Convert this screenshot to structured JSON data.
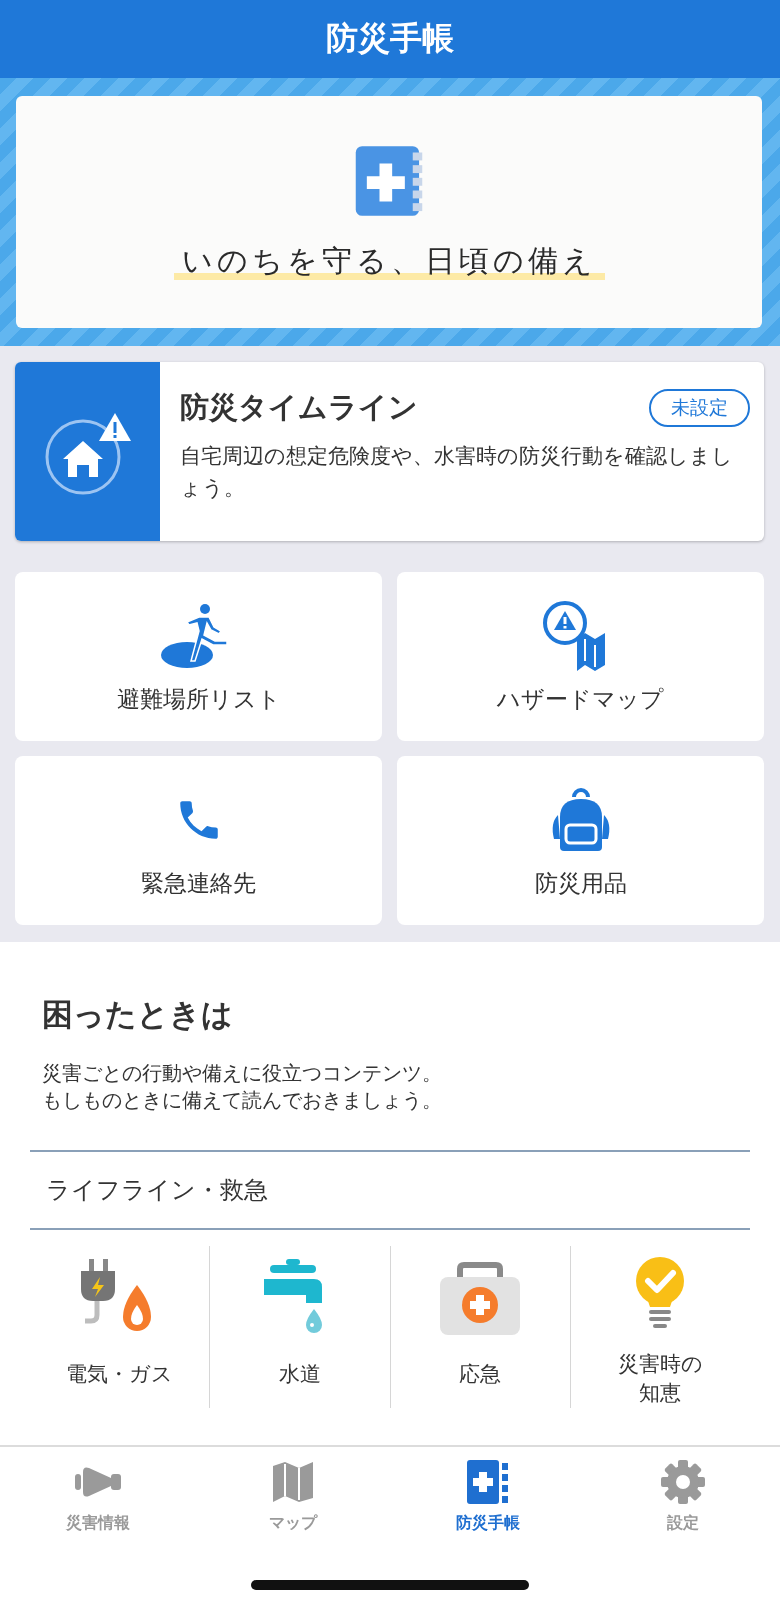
{
  "header": {
    "title": "防災手帳"
  },
  "banner": {
    "tagline": "いのちを守る、日頃の備え"
  },
  "timeline": {
    "title": "防災タイムライン",
    "status": "未設定",
    "description": "自宅周辺の想定危険度や、水害時の防災行動を確認しましょう。"
  },
  "menu": [
    {
      "label": "避難場所リスト"
    },
    {
      "label": "ハザードマップ"
    },
    {
      "label": "緊急連絡先"
    },
    {
      "label": "防災用品"
    }
  ],
  "help": {
    "title": "困ったときは",
    "description": [
      "災害ごとの行動や備えに役立つコンテンツ。",
      "もしものときに備えて読んでおきましょう。"
    ],
    "category": "ライフライン・救急",
    "items": [
      {
        "label": "電気・ガス"
      },
      {
        "label": "水道"
      },
      {
        "label": "応急"
      },
      {
        "label": "災害時の知恵"
      }
    ]
  },
  "tabs": [
    {
      "label": "災害情報",
      "selected": false
    },
    {
      "label": "マップ",
      "selected": false
    },
    {
      "label": "防災手帳",
      "selected": true
    },
    {
      "label": "設定",
      "selected": false
    }
  ]
}
